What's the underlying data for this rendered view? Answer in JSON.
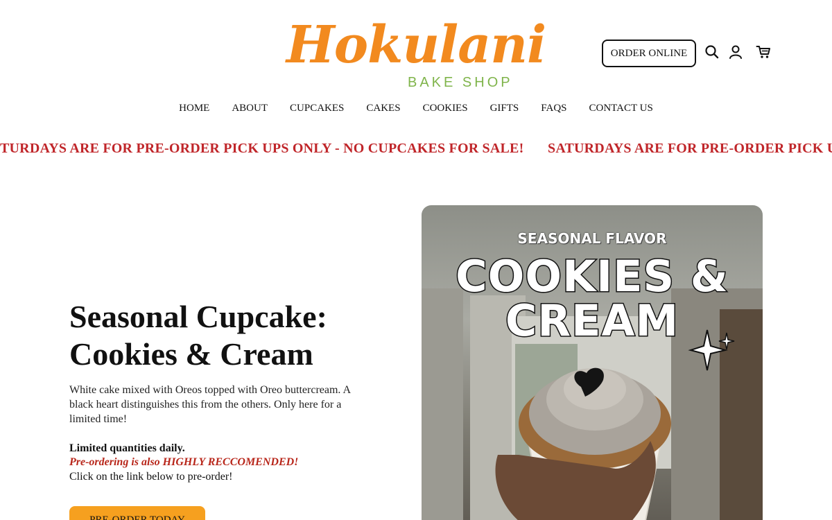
{
  "brand": {
    "name": "Hokulani",
    "tagline": "BAKE SHOP",
    "colors": {
      "script": "#f28a1f",
      "tagline": "#7fb44a",
      "alert": "#c0262a",
      "cta": "#f6a01f"
    }
  },
  "header": {
    "order_online_label": "ORDER ONLINE",
    "icons": [
      "search-icon",
      "account-icon",
      "cart-icon"
    ]
  },
  "nav": {
    "items": [
      {
        "label": "HOME"
      },
      {
        "label": "ABOUT"
      },
      {
        "label": "CUPCAKES"
      },
      {
        "label": "CAKES"
      },
      {
        "label": "COOKIES"
      },
      {
        "label": "GIFTS"
      },
      {
        "label": "FAQS"
      },
      {
        "label": "CONTACT US"
      }
    ]
  },
  "announcement": {
    "segment_1": "TURDAYS ARE FOR PRE-ORDER PICK UPS ONLY - NO CUPCAKES FOR SALE!",
    "segment_2": "SATURDAYS ARE FOR PRE-ORDER PICK UPS ONLY - NO CUPCAKES FOR SALE!"
  },
  "hero": {
    "title_line1": "Seasonal Cupcake:",
    "title_line2": "Cookies & Cream",
    "description": "White cake mixed with Oreos topped with Oreo buttercream. A black heart distinguishes this from the others. Only here for a limited time!",
    "limited_note": "Limited quantities daily.",
    "preorder_note": "Pre-ordering is also HIGHLY RECCOMENDED!",
    "click_note": "Click on the link below to pre-order!",
    "button_label": "PRE-ORDER TODAY"
  },
  "promo_image": {
    "kicker": "SEASONAL FLAVOR",
    "headline_line1": "COOKIES &",
    "headline_line2": "CREAM"
  }
}
